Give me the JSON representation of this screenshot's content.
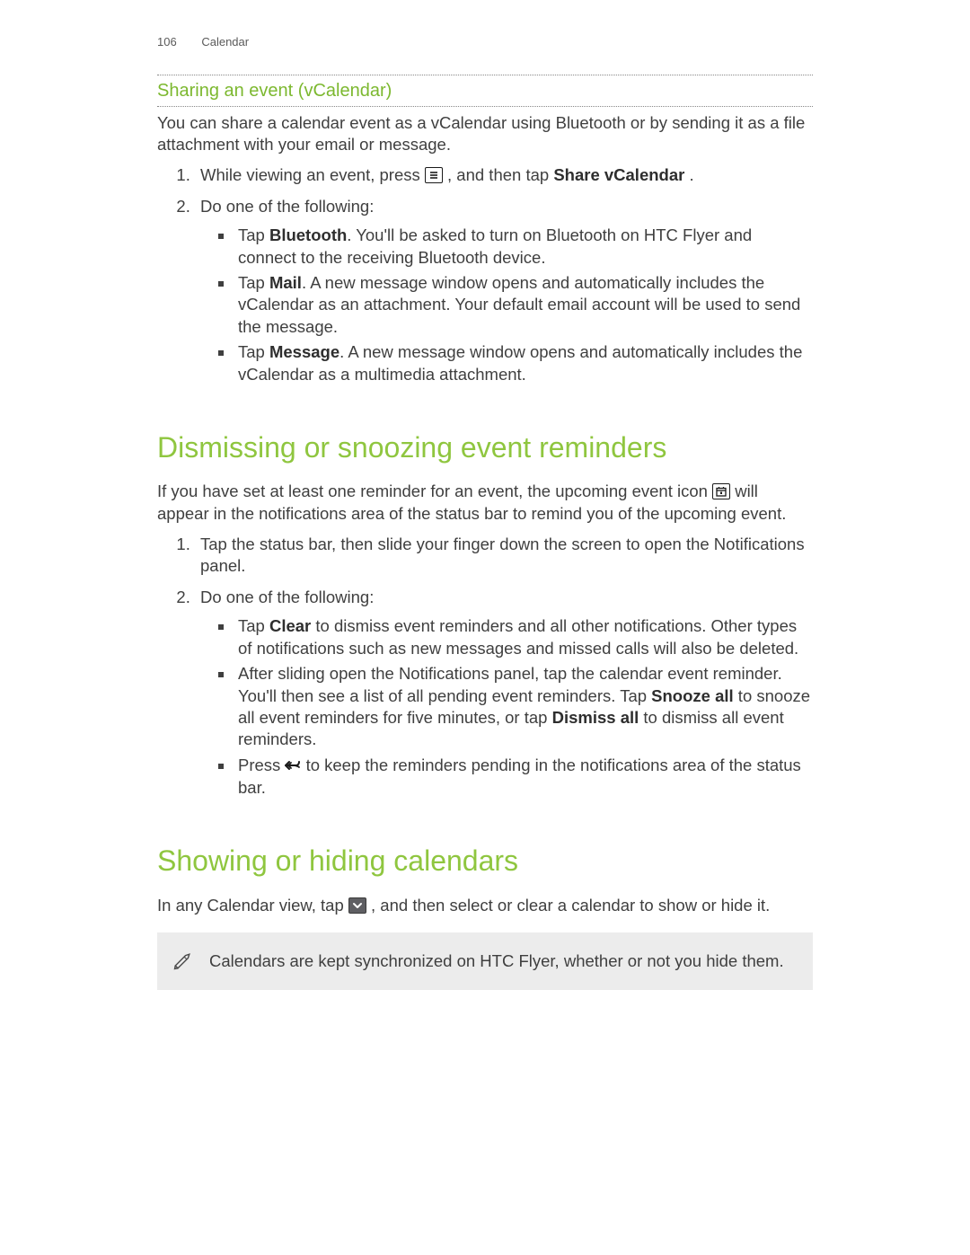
{
  "header": {
    "page_number": "106",
    "chapter": "Calendar"
  },
  "section1": {
    "title": "Sharing an event (vCalendar)",
    "intro": "You can share a calendar event as a vCalendar using Bluetooth or by sending it as a file attachment with your email or message.",
    "step1_pre": "While viewing an event, press ",
    "step1_post": ", and then tap ",
    "step1_action": "Share vCalendar",
    "step1_end": ".",
    "step2_intro": "Do one of the following:",
    "bullets": {
      "b1_pre": "Tap ",
      "b1_bold": "Bluetooth",
      "b1_post": ". You'll be asked to turn on Bluetooth on HTC Flyer and connect to the receiving Bluetooth device.",
      "b2_pre": "Tap ",
      "b2_bold": "Mail",
      "b2_post": ". A new message window opens and automatically includes the vCalendar as an attachment. Your default email account will be used to send the message.",
      "b3_pre": "Tap ",
      "b3_bold": "Message",
      "b3_post": ". A new message window opens and automatically includes the vCalendar as a multimedia attachment."
    }
  },
  "section2": {
    "title": "Dismissing or snoozing event reminders",
    "intro_pre": "If you have set at least one reminder for an event, the upcoming event icon ",
    "intro_post": " will appear in the notifications area of the status bar to remind you of the upcoming event.",
    "step1": "Tap the status bar, then slide your finger down the screen to open the Notifications panel.",
    "step2_intro": "Do one of the following:",
    "bullets": {
      "b1_pre": "Tap ",
      "b1_bold": "Clear",
      "b1_post": " to dismiss event reminders and all other notifications. Other types of notifications such as new messages and missed calls will also be deleted.",
      "b2_pre": "After sliding open the Notifications panel, tap the calendar event reminder. You'll then see a list of all pending event reminders. Tap ",
      "b2_bold1": "Snooze all",
      "b2_mid": " to snooze all event reminders for five minutes, or tap ",
      "b2_bold2": "Dismiss all",
      "b2_post": " to dismiss all event reminders.",
      "b3_pre": "Press ",
      "b3_post": " to keep the reminders pending in the notifications area of the status bar."
    }
  },
  "section3": {
    "title": "Showing or hiding calendars",
    "intro_pre": "In any Calendar view, tap ",
    "intro_post": ", and then select or clear a calendar to show or hide it.",
    "note": "Calendars are kept synchronized on HTC Flyer, whether or not you hide them."
  }
}
